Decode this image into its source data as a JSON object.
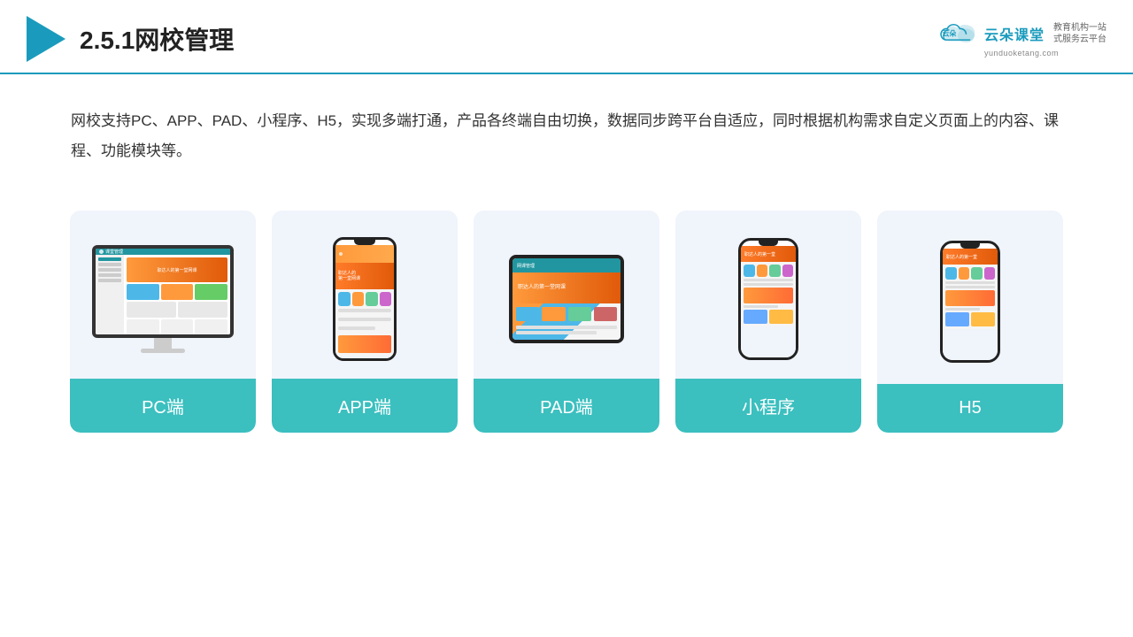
{
  "header": {
    "title": "2.5.1网校管理",
    "logo": {
      "name_cn": "云朵课堂",
      "name_en": "yunduoketang.com",
      "slogan": "教育机构一站\n式服务云平台"
    }
  },
  "description": "网校支持PC、APP、PAD、小程序、H5，实现多端打通，产品各终端自由切换，数据同步跨平台自适应，同时根据机构需求自定义页面上的内容、课程、功能模块等。",
  "cards": [
    {
      "id": "pc",
      "label": "PC端",
      "device": "pc"
    },
    {
      "id": "app",
      "label": "APP端",
      "device": "phone"
    },
    {
      "id": "pad",
      "label": "PAD端",
      "device": "tablet"
    },
    {
      "id": "miniapp",
      "label": "小程序",
      "device": "phone-small"
    },
    {
      "id": "h5",
      "label": "H5",
      "device": "phone-small"
    }
  ],
  "colors": {
    "accent": "#3bbfbf",
    "header_line": "#1a9bbd",
    "title": "#222222",
    "text": "#333333",
    "card_bg": "#f0f4fb"
  }
}
